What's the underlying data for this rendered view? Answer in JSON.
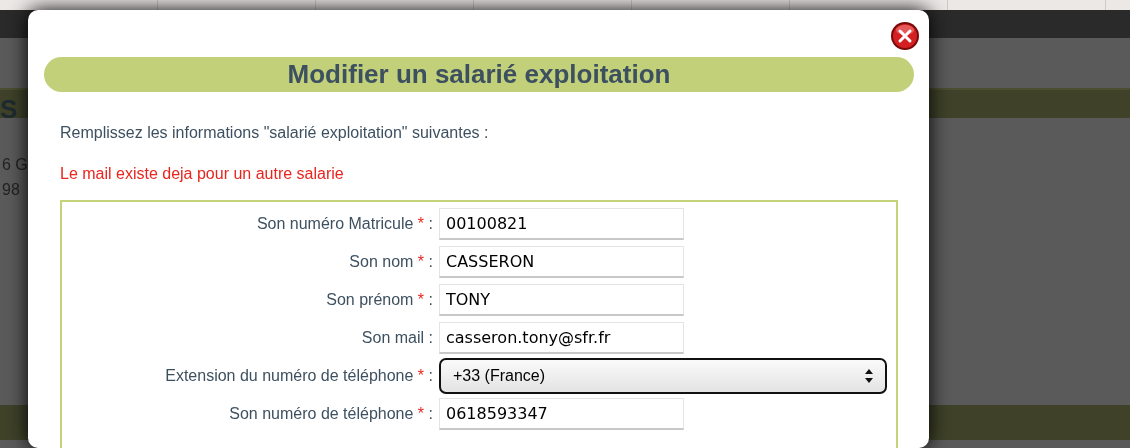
{
  "background": {
    "heading": "S",
    "lines": [
      "6 G",
      "98"
    ]
  },
  "dialog": {
    "title": "Modifier un salarié exploitation",
    "intro": "Remplissez les informations \"salarié exploitation\" suivantes :",
    "error": "Le mail existe deja pour un autre salarie",
    "fields": [
      {
        "kind": "text",
        "label": "Son numéro Matricule",
        "required_mark": "*",
        "separator": ":",
        "value": "00100821"
      },
      {
        "kind": "text",
        "label": "Son nom",
        "required_mark": "*",
        "separator": ":",
        "value": "CASSERON"
      },
      {
        "kind": "text",
        "label": "Son prénom",
        "required_mark": "*",
        "separator": ":",
        "value": "TONY"
      },
      {
        "kind": "text",
        "label": "Son mail",
        "separator": ":",
        "value": "casseron.tony@sfr.fr"
      },
      {
        "kind": "select",
        "label": "Extension du numéro de téléphone",
        "required_mark": "*",
        "separator": ":",
        "value": "+33 (France)"
      },
      {
        "kind": "text",
        "label": "Son numéro de téléphone",
        "required_mark": "*",
        "separator": ":",
        "value": "0618593347"
      }
    ]
  }
}
